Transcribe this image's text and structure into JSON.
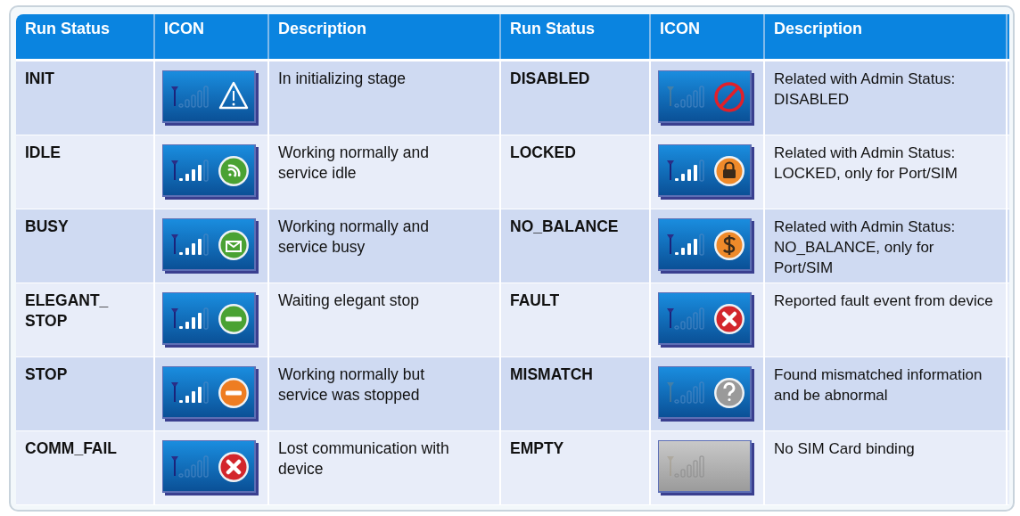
{
  "table": {
    "columns": [
      "Run Status",
      "ICON",
      "Description",
      "Run Status",
      "ICON",
      "Description"
    ],
    "rows": [
      [
        "INIT",
        {
          "kind": "warning",
          "connected": false,
          "antenna_active": true,
          "greyed": false
        },
        "In initializing stage",
        "DISABLED",
        {
          "kind": "forbidden",
          "connected": false,
          "antenna_active": false,
          "greyed": false
        },
        "Related with Admin Status: DISABLED"
      ],
      [
        "IDLE",
        {
          "kind": "signal",
          "connected": true,
          "antenna_active": true,
          "greyed": false
        },
        "Working normally and service idle",
        "LOCKED",
        {
          "kind": "lock",
          "connected": true,
          "antenna_active": true,
          "greyed": false
        },
        "Related with Admin Status: LOCKED, only for Port/SIM"
      ],
      [
        "BUSY",
        {
          "kind": "mail",
          "connected": true,
          "antenna_active": true,
          "greyed": false
        },
        "Working normally and service busy",
        "NO_BALANCE",
        {
          "kind": "dollar",
          "connected": true,
          "antenna_active": true,
          "greyed": false
        },
        "Related with Admin Status: NO_BALANCE, only for Port/SIM"
      ],
      [
        "ELEGANT_\nSTOP",
        {
          "kind": "minus-green",
          "connected": true,
          "antenna_active": true,
          "greyed": false
        },
        "Waiting elegant stop",
        "FAULT",
        {
          "kind": "cross",
          "connected": false,
          "antenna_active": true,
          "greyed": false
        },
        "Reported fault event from device"
      ],
      [
        "STOP",
        {
          "kind": "minus-orange",
          "connected": true,
          "antenna_active": true,
          "greyed": false
        },
        "Working normally but service was stopped",
        "MISMATCH",
        {
          "kind": "question",
          "connected": false,
          "antenna_active": false,
          "greyed": false
        },
        "Found mismatched information and be abnormal"
      ],
      [
        "COMM_FAIL",
        {
          "kind": "cross",
          "connected": false,
          "antenna_active": true,
          "greyed": false
        },
        "Lost communication with device",
        "EMPTY",
        {
          "kind": "none",
          "connected": false,
          "antenna_active": false,
          "greyed": true
        },
        "No SIM Card binding"
      ]
    ]
  }
}
